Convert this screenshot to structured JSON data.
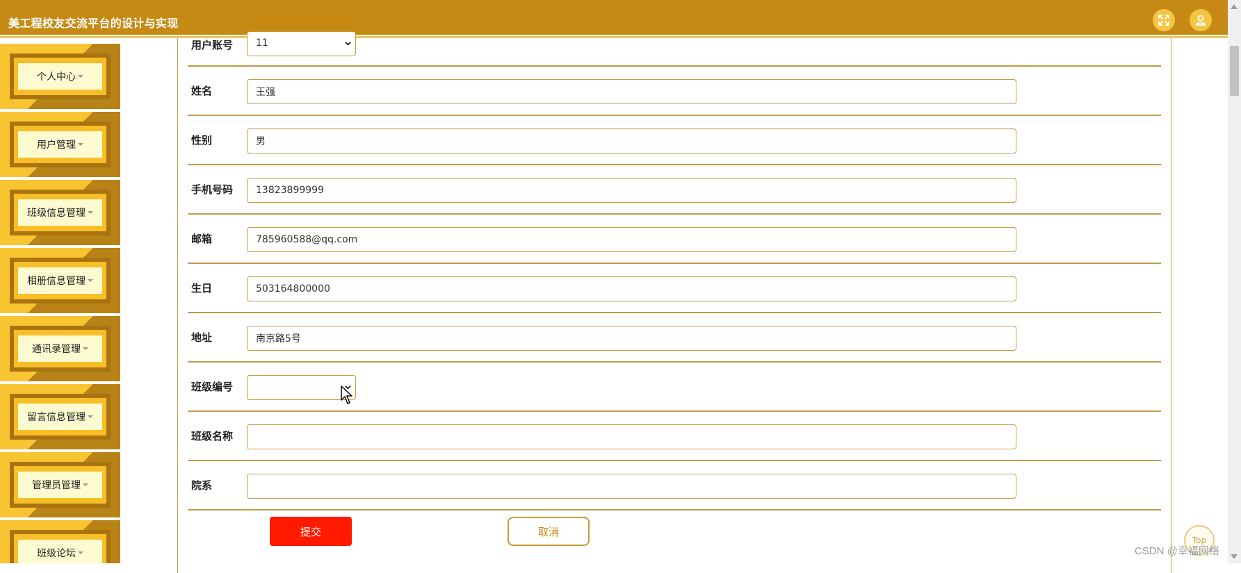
{
  "header": {
    "title": "美工程校友交流平台的设计与实现",
    "background_color": "#c68a14",
    "fullscreen_icon": "expand-arrows-icon",
    "user_icon": "user-icon"
  },
  "sidebar": {
    "items": [
      {
        "label": "个人中心"
      },
      {
        "label": "用户管理"
      },
      {
        "label": "班级信息管理"
      },
      {
        "label": "相册信息管理"
      },
      {
        "label": "通讯录管理"
      },
      {
        "label": "留言信息管理"
      },
      {
        "label": "管理员管理"
      },
      {
        "label": "班级论坛"
      }
    ],
    "accent_color": "#f9c432"
  },
  "form": {
    "top_field": {
      "label": "用户账号",
      "value": "11"
    },
    "fields": [
      {
        "label": "姓名",
        "value": "王强",
        "type": "text"
      },
      {
        "label": "性别",
        "value": "男",
        "type": "text"
      },
      {
        "label": "手机号码",
        "value": "13823899999",
        "type": "text"
      },
      {
        "label": "邮箱",
        "value": "785960588@qq.com",
        "type": "text"
      },
      {
        "label": "生日",
        "value": "503164800000",
        "type": "text"
      },
      {
        "label": "地址",
        "value": "南京路5号",
        "type": "text"
      },
      {
        "label": "班级编号",
        "value": "",
        "type": "select"
      },
      {
        "label": "班级名称",
        "value": "",
        "type": "text"
      },
      {
        "label": "院系",
        "value": "",
        "type": "text"
      }
    ],
    "submit_label": "提交",
    "cancel_label": "取消",
    "submit_color": "#ff1a00"
  },
  "top_button": {
    "label": "Top"
  },
  "watermark": "CSDN @幸福网络"
}
